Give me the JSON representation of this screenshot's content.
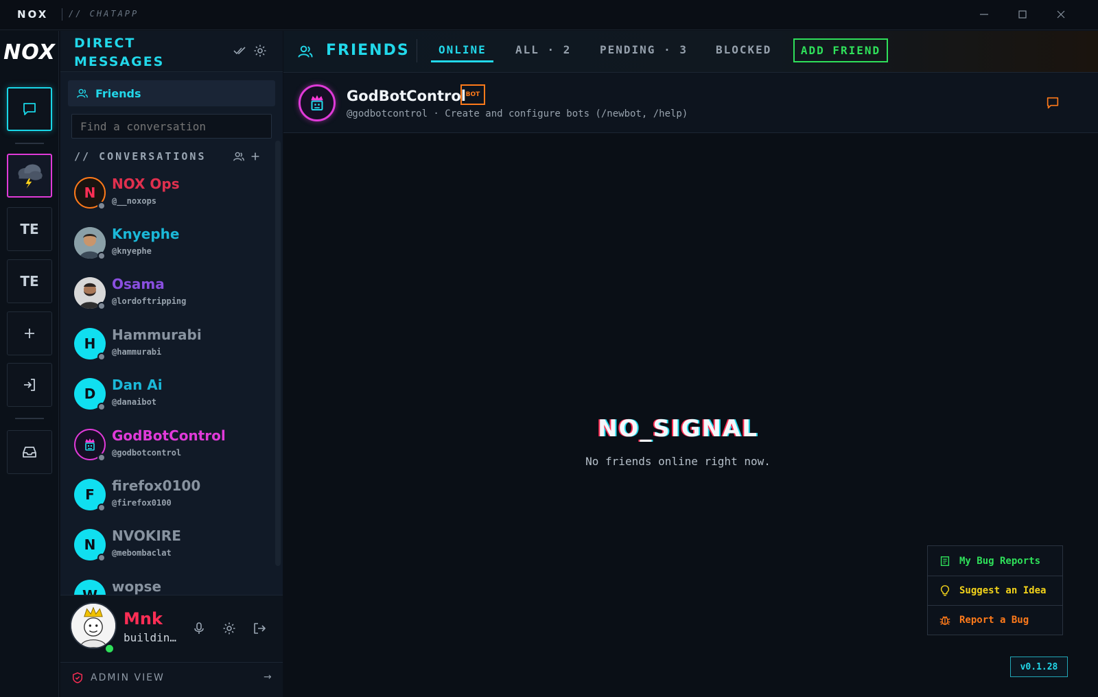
{
  "titlebar": {
    "brand": "NOX",
    "app": "// CHATAPP"
  },
  "rail": {
    "logo": "NOX",
    "servers": [
      {
        "label": "TE"
      },
      {
        "label": "TE"
      }
    ]
  },
  "dm": {
    "title": "DIRECT MESSAGES",
    "friends_label": "Friends",
    "search_placeholder": "Find a conversation",
    "conversations_header": "// CONVERSATIONS",
    "items": [
      {
        "name": "NOX Ops",
        "handle": "@__noxops",
        "initial": "N",
        "name_color": "#e0304e"
      },
      {
        "name": "Knyephe",
        "handle": "@knyephe",
        "initial": "",
        "name_color": "#1bb8d8"
      },
      {
        "name": "Osama",
        "handle": "@lordoftripping",
        "initial": "",
        "name_color": "#8a4fe0"
      },
      {
        "name": "Hammurabi",
        "handle": "@hammurabi",
        "initial": "H",
        "name_color": "#8893a0"
      },
      {
        "name": "Dan Ai",
        "handle": "@danaibot",
        "initial": "D",
        "name_color": "#1bb8d8"
      },
      {
        "name": "GodBotControl",
        "handle": "@godbotcontrol",
        "initial": "",
        "name_color": "#e03ad8"
      },
      {
        "name": "firefox0100",
        "handle": "@firefox0100",
        "initial": "F",
        "name_color": "#8893a0"
      },
      {
        "name": "NVOKIRE",
        "handle": "@mebombaclat",
        "initial": "N",
        "name_color": "#8893a0"
      },
      {
        "name": "wopse",
        "handle": "",
        "initial": "W",
        "name_color": "#8893a0"
      }
    ]
  },
  "user": {
    "name": "Mnk",
    "status": "buildin…"
  },
  "admin": {
    "label": "ADMIN VIEW",
    "arrow": "→"
  },
  "main": {
    "title": "FRIENDS",
    "tabs": [
      {
        "label": "ONLINE"
      },
      {
        "label": "ALL · 2"
      },
      {
        "label": "PENDING · 3"
      },
      {
        "label": "BLOCKED"
      }
    ],
    "add_friend": "ADD FRIEND",
    "friend": {
      "name": "GodBotControl",
      "badge": "BOT",
      "desc": "@godbotcontrol · Create and configure bots (/newbot, /help)"
    },
    "empty_title": "NO_SIGNAL",
    "empty_sub": "No friends online right now."
  },
  "help": {
    "my_reports": "My Bug Reports",
    "suggest": "Suggest an Idea",
    "report": "Report a Bug"
  },
  "version": "v0.1.28",
  "colors": {
    "accent": "#22d8ea",
    "magenta": "#e03ad8",
    "green": "#2fe05a",
    "orange": "#ff7a1a",
    "red": "#ff2e55"
  }
}
